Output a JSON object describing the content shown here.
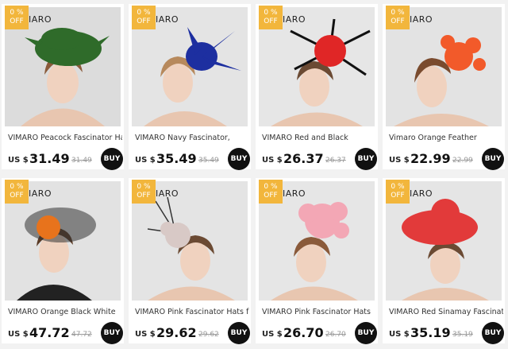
{
  "products": [
    {
      "brand": "IARO",
      "badge_top": "0 %",
      "badge_bottom": "OFF",
      "title": "VIMARO Peacock Fascinator Hat",
      "currency": "US $",
      "price": "31.49",
      "old_price": "31.49",
      "buy_label": "BUY",
      "hat_color": "#2f6b2a",
      "bg_color": "#dcdcdc"
    },
    {
      "brand": "IARO",
      "badge_top": "0 %",
      "badge_bottom": "OFF",
      "title": "VIMARO Navy Fascinator,",
      "currency": "US $",
      "price": "35.49",
      "old_price": "35.49",
      "buy_label": "BUY",
      "hat_color": "#1d2fa0",
      "bg_color": "#e4e4e4"
    },
    {
      "brand": "IARO",
      "badge_top": "0 %",
      "badge_bottom": "OFF",
      "title": "VIMARO Red and Black",
      "currency": "US $",
      "price": "26.37",
      "old_price": "26.37",
      "buy_label": "BUY",
      "hat_color": "#e02626",
      "bg_color": "#e6e6e6"
    },
    {
      "brand": "IARO",
      "badge_top": "0 %",
      "badge_bottom": "OFF",
      "title": "Vimaro Orange Feather",
      "currency": "US $",
      "price": "22.99",
      "old_price": "22.99",
      "buy_label": "BUY",
      "hat_color": "#f25a2a",
      "bg_color": "#e3e3e3"
    },
    {
      "brand": "IARO",
      "badge_top": "0 %",
      "badge_bottom": "OFF",
      "title": "VIMARO Orange Black White",
      "currency": "US $",
      "price": "47.72",
      "old_price": "47.72",
      "buy_label": "BUY",
      "hat_color": "#e8731c",
      "bg_color": "#e2e2e2"
    },
    {
      "brand": "IARO",
      "badge_top": "0 %",
      "badge_bottom": "OFF",
      "title": "VIMARO Pink Fascinator Hats for",
      "currency": "US $",
      "price": "29.62",
      "old_price": "29.62",
      "buy_label": "BUY",
      "hat_color": "#d8c9c6",
      "bg_color": "#e4e4e4"
    },
    {
      "brand": "IARO",
      "badge_top": "0 %",
      "badge_bottom": "OFF",
      "title": "VIMARO Pink Fascinator Hats",
      "currency": "US $",
      "price": "26.70",
      "old_price": "26.70",
      "buy_label": "BUY",
      "hat_color": "#f3a7b5",
      "bg_color": "#e6e6e6"
    },
    {
      "brand": "IARO",
      "badge_top": "0 %",
      "badge_bottom": "OFF",
      "title": "VIMARO Red Sinamay Fascinators",
      "currency": "US $",
      "price": "35.19",
      "old_price": "35.19",
      "buy_label": "BUY",
      "hat_color": "#e23a3a",
      "bg_color": "#e5e5e5"
    }
  ]
}
